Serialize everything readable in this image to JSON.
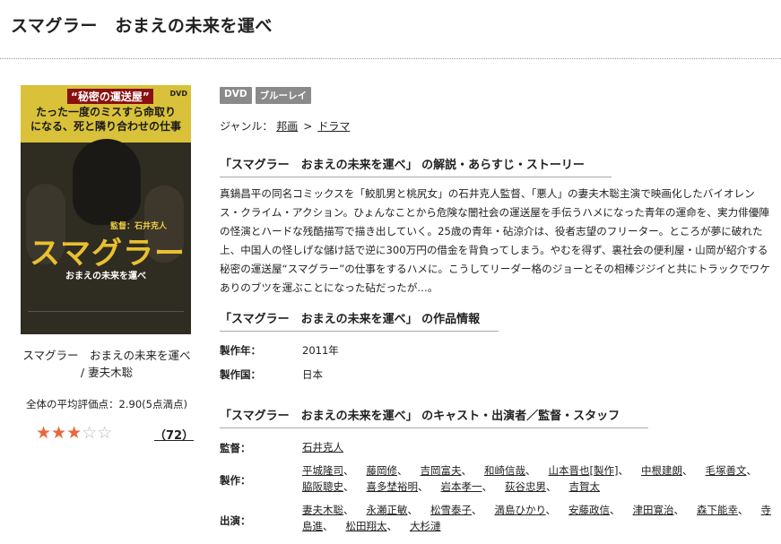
{
  "page": {
    "title": "スマグラー　おまえの未来を運べ"
  },
  "poster": {
    "tag": "“秘密の運送屋”",
    "dvd_mark": "DVD",
    "catch": "たった一度のミスすら命取り\nになる、死と隣り合わせの仕事",
    "director": "監督：石井克人",
    "logo": "スマグラー",
    "subtitle": "おまえの未来を運べ"
  },
  "product": {
    "title_line1": "スマグラー　おまえの未来を運べ",
    "title_line2": "/ 妻夫木聡",
    "rating_summary": "全体の平均評価点：2.90(5点満点)",
    "stars_filled": 3,
    "stars_total": 5,
    "stars_full_glyphs": "★★★",
    "stars_empty_glyphs": "☆☆",
    "review_count": "（72）"
  },
  "badges": [
    "DVD",
    "ブルーレイ"
  ],
  "genre": {
    "label": "ジャンル：",
    "path": [
      "邦画",
      "ドラマ"
    ],
    "separator": ">"
  },
  "sections": {
    "synopsis_heading": "「スマグラー　おまえの未来を運べ」 の解説・あらすじ・ストーリー",
    "synopsis": "真鍋昌平の同名コミックスを「鮫肌男と桃尻女」の石井克人監督、「悪人」の妻夫木聡主演で映画化したバイオレンス・クライム・アクション。ひょんなことから危険な闇社会の運送屋を手伝うハメになった青年の運命を、実力俳優陣の怪演とハードな残酷描写で描き出していく。25歳の青年・砧涼介は、役者志望のフリーター。ところが夢に破れた上、中国人の怪しげな儲け話で逆に300万円の借金を背負ってしまう。やむを得ず、裏社会の便利屋・山岡が紹介する秘密の運送屋“スマグラー”の仕事をするハメに。こうしてリーダー格のジョーとその相棒ジジイと共にトラックでワケありのブツを運ぶことになった砧だったが…。",
    "info_heading": "「スマグラー　おまえの未来を運べ」 の作品情報",
    "info": [
      {
        "label": "製作年：",
        "value": "2011年"
      },
      {
        "label": "製作国：",
        "value": "日本"
      }
    ],
    "cast_heading": "「スマグラー　おまえの未来を運べ」 のキャスト・出演者／監督・スタッフ",
    "credits": {
      "director_label": "監督：",
      "directors": [
        "石井克人"
      ],
      "production_label": "製作：",
      "production": [
        "平城隆司",
        "藤岡修",
        "吉岡富夫",
        "和崎信哉",
        "山本晋也[製作]",
        "中根建朗",
        "毛塚善文",
        "脇阪聰史",
        "喜多埜裕明",
        "岩本孝一",
        "荻谷忠男",
        "吉賀太"
      ],
      "cast_label": "出演：",
      "cast": [
        "妻夫木聡",
        "永瀬正敏",
        "松雪泰子",
        "満島ひかり",
        "安藤政信",
        "津田寛治",
        "森下能幸",
        "寺島進",
        "松田翔太",
        "大杉漣"
      ]
    }
  }
}
